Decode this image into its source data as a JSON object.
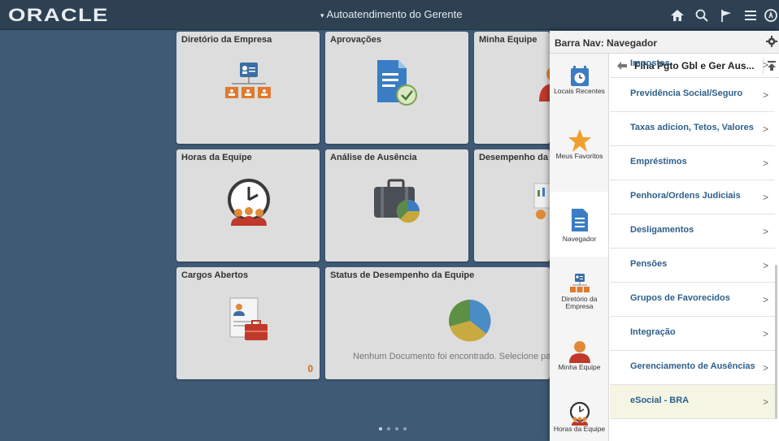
{
  "header": {
    "logo_text": "ORACLE",
    "title": "Autoatendimento do Gerente",
    "title_caret": "▾",
    "icons": [
      "home-icon",
      "search-icon",
      "flag-icon",
      "menu-icon",
      "navbar-icon"
    ]
  },
  "tiles": {
    "diretorio": {
      "title": "Diretório da Empresa"
    },
    "aprovacoes": {
      "title": "Aprovações"
    },
    "minha_equipe": {
      "title": "Minha Equipe"
    },
    "horas": {
      "title": "Horas da Equipe"
    },
    "ausencia": {
      "title": "Análise de Ausência"
    },
    "desempenho": {
      "title": "Desempenho da E"
    },
    "cargos": {
      "title": "Cargos Abertos",
      "count": "0"
    },
    "status": {
      "title": "Status de Desempenho da Equipe",
      "message": "Nenhum Documento foi encontrado. Selecione para c"
    }
  },
  "navpanel": {
    "title": "Barra Nav: Navegador",
    "left_items": [
      {
        "label": "Locais Recentes",
        "icon": "clock-icon"
      },
      {
        "label": "Meus Favoritos",
        "icon": "star-icon"
      },
      {
        "label": "Navegador",
        "icon": "document-icon"
      },
      {
        "label": "Diretório da Empresa",
        "icon": "org-chart-icon"
      },
      {
        "label": "Minha Equipe",
        "icon": "people-icon"
      },
      {
        "label": "Horas da Equipe",
        "icon": "clock-people-icon"
      }
    ],
    "breadcrumb": "Flha Pgto Gbl e Ger Aus...",
    "partial_item": "Impostos",
    "items": [
      {
        "label": "Previdência Social/Seguro"
      },
      {
        "label": "Taxas adicion, Tetos, Valores"
      },
      {
        "label": "Empréstimos"
      },
      {
        "label": "Penhora/Ordens Judiciais"
      },
      {
        "label": "Desligamentos"
      },
      {
        "label": "Pensões"
      },
      {
        "label": "Grupos de Favorecidos"
      },
      {
        "label": "Integração"
      },
      {
        "label": "Gerenciamento de Ausências"
      },
      {
        "label": "eSocial - BRA"
      }
    ],
    "chevron": ">"
  },
  "colors": {
    "header_bg": "#2d4152",
    "page_bg": "#3f5a75",
    "tile_bg": "#dddddd",
    "link_blue": "#2d5f8b",
    "accent_orange": "#f0a030"
  }
}
